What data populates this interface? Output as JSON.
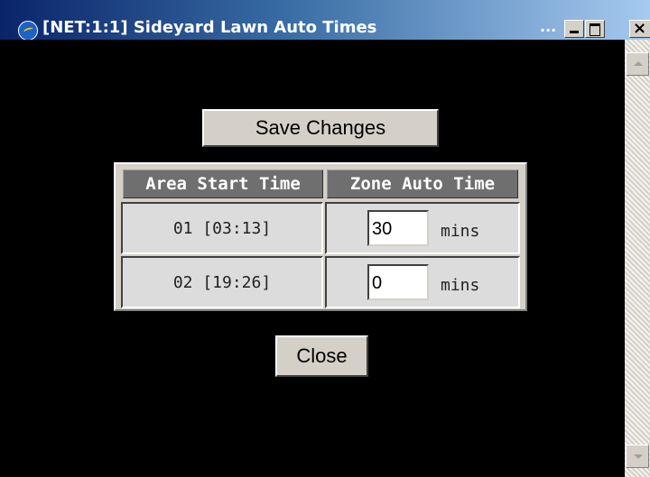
{
  "window": {
    "title": "[NET:1:1] Sideyard Lawn Auto Times",
    "title_ellipsis": "...",
    "close_glyph": "×"
  },
  "actions": {
    "save_label": "Save Changes",
    "close_label": "Close"
  },
  "table": {
    "headers": [
      "Area Start Time",
      "Zone Auto Time"
    ],
    "rows": [
      {
        "area_start_time": "01 [03:13]",
        "zone_auto_time": "30",
        "unit": "mins"
      },
      {
        "area_start_time": "02 [19:26]",
        "zone_auto_time": "0",
        "unit": "mins"
      }
    ]
  },
  "colors": {
    "titlebar_start": "#0a246a",
    "titlebar_end": "#a6caf0",
    "background": "#000000",
    "header_bg": "#6f6f6f",
    "cell_bg": "#dcdcdc"
  },
  "icons": {
    "app": "internet-explorer-icon",
    "minimize": "minimize-icon",
    "maximize": "maximize-icon",
    "close": "close-icon",
    "scroll_up": "scroll-up-arrow-icon",
    "scroll_down": "scroll-down-arrow-icon"
  }
}
